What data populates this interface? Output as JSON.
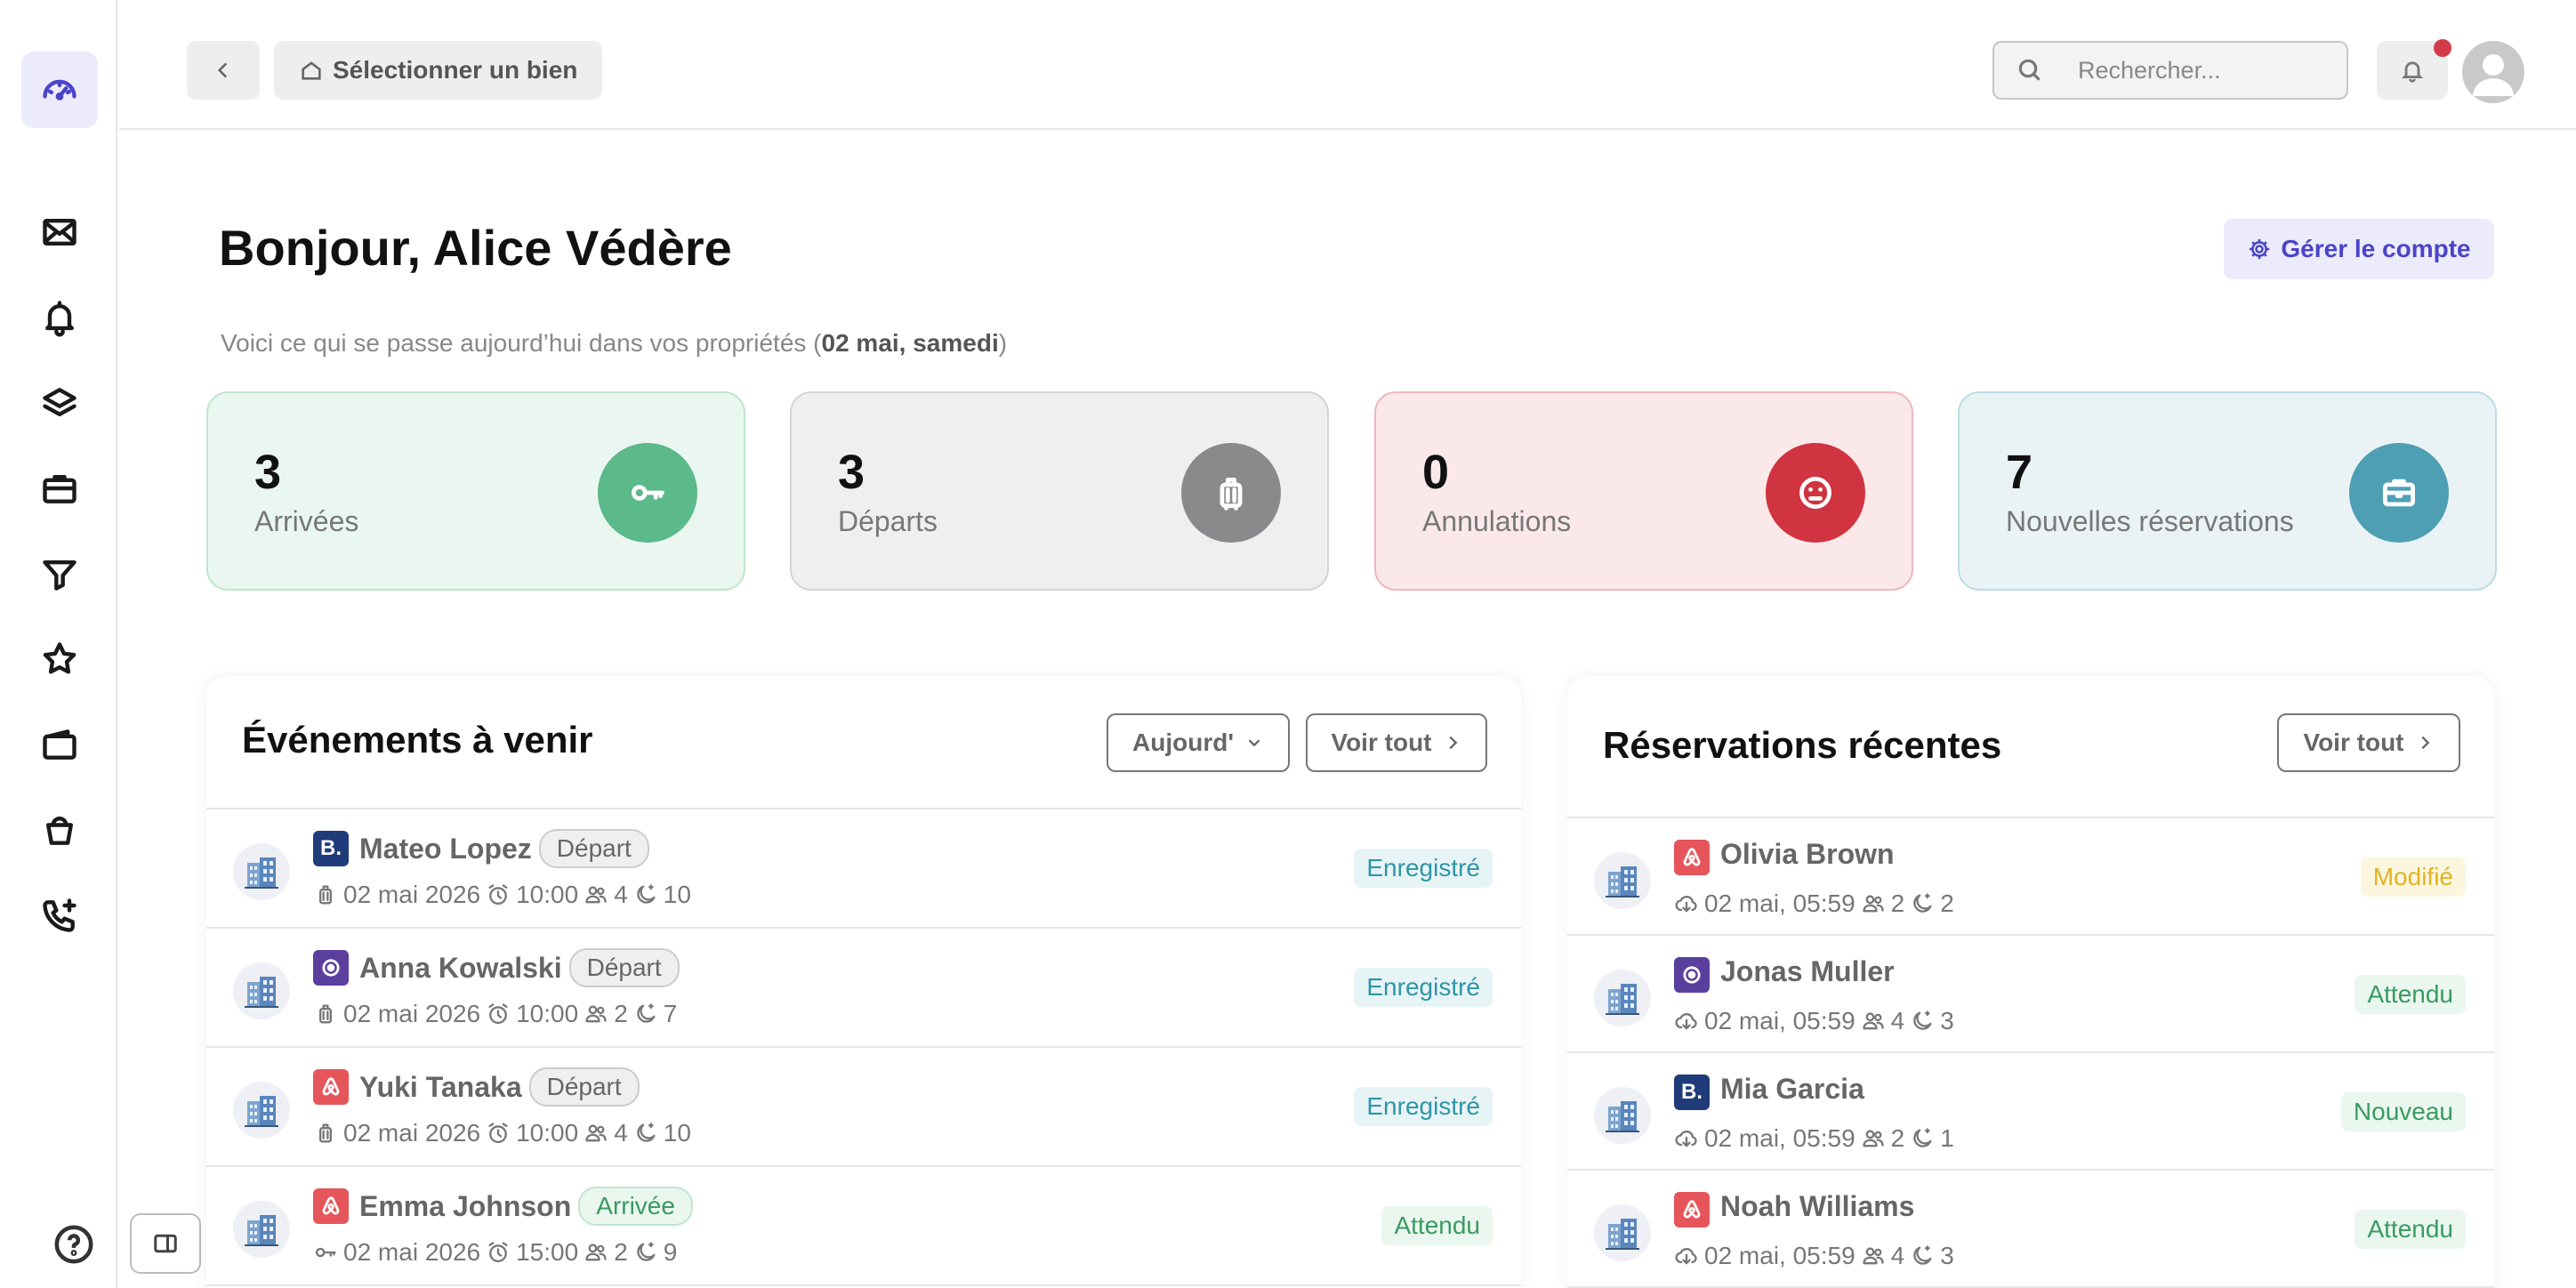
{
  "header": {
    "select_property_label": "Sélectionner un bien",
    "search_placeholder": "Rechercher..."
  },
  "greeting": {
    "hello": "Bonjour,",
    "user_name": "Alice Védère",
    "subtitle_prefix": "Voici ce qui se passe aujourd’hui dans vos propriétés (",
    "subtitle_date": "02 mai, samedi",
    "subtitle_suffix": ")",
    "manage_account_label": "Gérer le compte"
  },
  "stats": [
    {
      "value": "3",
      "label": "Arrivées",
      "icon": "key-icon",
      "bg": "#eaf7f0",
      "border": "#bfe6cf",
      "circle": "#5bb98a"
    },
    {
      "value": "3",
      "label": "Départs",
      "icon": "luggage-icon",
      "bg": "#efefef",
      "border": "#d4d4d4",
      "circle": "#8a8a8d"
    },
    {
      "value": "0",
      "label": "Annulations",
      "icon": "sad-face-icon",
      "bg": "#fbe9ea",
      "border": "#efb8bd",
      "circle": "#cf3440"
    },
    {
      "value": "7",
      "label": "Nouvelles réservations",
      "icon": "briefcase-icon",
      "bg": "#e9f3f5",
      "border": "#bcdde4",
      "circle": "#4e9fb4"
    }
  ],
  "events": {
    "title": "Événements à venir",
    "filter_label": "Aujourd'",
    "view_all_label": "Voir tout",
    "rows": [
      {
        "source": "booking",
        "name": "Mateo Lopez",
        "tag": "Départ",
        "tag_type": "depart",
        "date": "02 mai 2026",
        "time": "10:00",
        "guests": "4",
        "nights": "10",
        "status": "Enregistré",
        "status_type": "enr"
      },
      {
        "source": "vrbo",
        "name": "Anna Kowalski",
        "tag": "Départ",
        "tag_type": "depart",
        "date": "02 mai 2026",
        "time": "10:00",
        "guests": "2",
        "nights": "7",
        "status": "Enregistré",
        "status_type": "enr"
      },
      {
        "source": "airbnb",
        "name": "Yuki Tanaka",
        "tag": "Départ",
        "tag_type": "depart",
        "date": "02 mai 2026",
        "time": "10:00",
        "guests": "4",
        "nights": "10",
        "status": "Enregistré",
        "status_type": "enr"
      },
      {
        "source": "airbnb",
        "name": "Emma Johnson",
        "tag": "Arrivée",
        "tag_type": "arrivee",
        "date": "02 mai 2026",
        "time": "15:00",
        "guests": "2",
        "nights": "9",
        "status": "Attendu",
        "status_type": "att"
      }
    ]
  },
  "reservations": {
    "title": "Réservations récentes",
    "view_all_label": "Voir tout",
    "rows": [
      {
        "source": "airbnb",
        "name": "Olivia Brown",
        "datetime": "02 mai, 05:59",
        "guests": "2",
        "nights": "2",
        "status": "Modifié",
        "status_type": "mod"
      },
      {
        "source": "vrbo",
        "name": "Jonas Muller",
        "datetime": "02 mai, 05:59",
        "guests": "4",
        "nights": "3",
        "status": "Attendu",
        "status_type": "att"
      },
      {
        "source": "booking",
        "name": "Mia Garcia",
        "datetime": "02 mai, 05:59",
        "guests": "2",
        "nights": "1",
        "status": "Nouveau",
        "status_type": "nou"
      },
      {
        "source": "airbnb",
        "name": "Noah Williams",
        "datetime": "02 mai, 05:59",
        "guests": "4",
        "nights": "3",
        "status": "Attendu",
        "status_type": "att"
      }
    ]
  },
  "source_colors": {
    "booking": "#1f3b7a",
    "vrbo": "#5a3f9e",
    "airbnb": "#e5555a"
  },
  "sidebar_icons": [
    "dashboard-icon",
    "mail-icon",
    "bell-icon",
    "layers-icon",
    "briefcase-icon",
    "filter-icon",
    "star-icon",
    "wallet-icon",
    "bucket-icon",
    "phone-plus-icon"
  ]
}
